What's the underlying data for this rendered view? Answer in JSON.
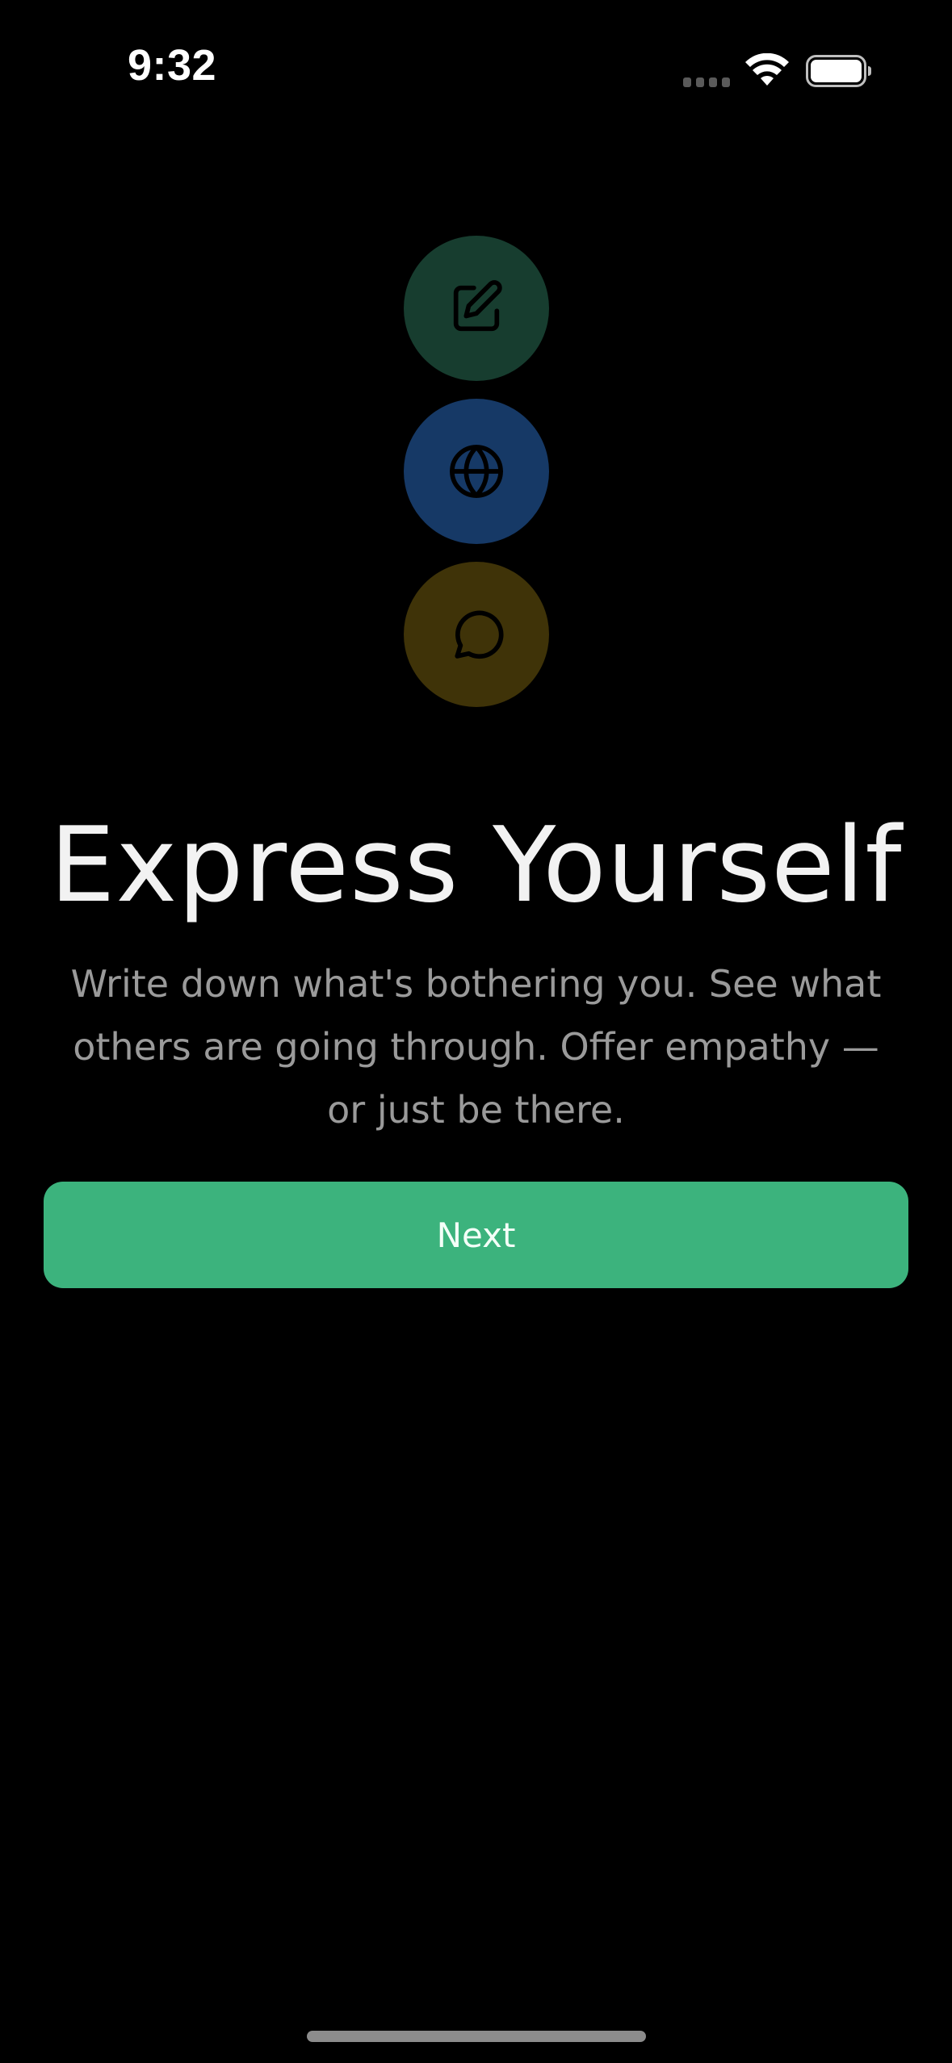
{
  "status_bar": {
    "time": "9:32"
  },
  "icons": [
    {
      "name": "pencil-square-icon",
      "background": "#173d2f"
    },
    {
      "name": "globe-icon",
      "background": "#163966"
    },
    {
      "name": "chat-bubble-icon",
      "background": "#3f3308"
    }
  ],
  "onboarding": {
    "title": "Express Yourself",
    "subtitle": "Write down what's bothering you. See what others are going through. Offer empathy — or just be there.",
    "next_label": "Next"
  },
  "colors": {
    "background": "#000000",
    "accent": "#3cb37d",
    "title_text": "#f2f2f2",
    "subtitle_text": "#9a9a9a"
  }
}
